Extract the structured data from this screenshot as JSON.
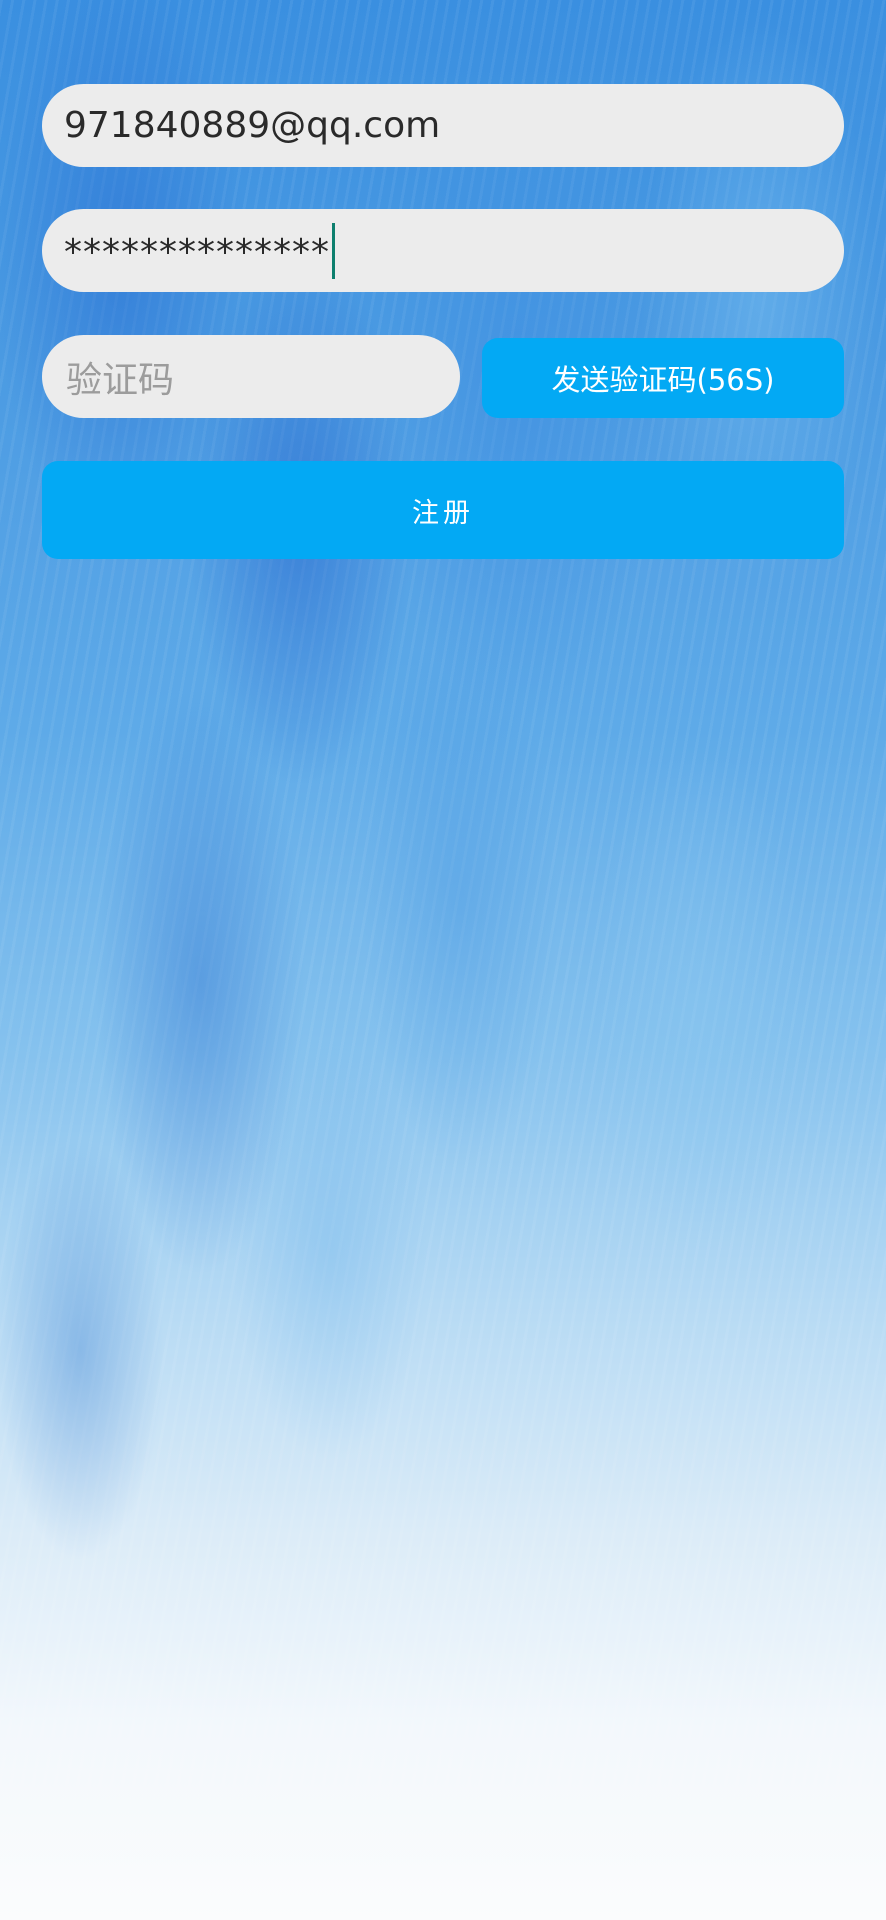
{
  "form": {
    "email_value": "971840889@qq.com",
    "password_masked": "**************",
    "code_placeholder": "验证码",
    "send_code_label": "发送验证码(56S)",
    "register_label": "注册"
  },
  "colors": {
    "field_bg": "#ececec",
    "button_bg": "#03a9f4",
    "caret": "#0d7f6e"
  }
}
